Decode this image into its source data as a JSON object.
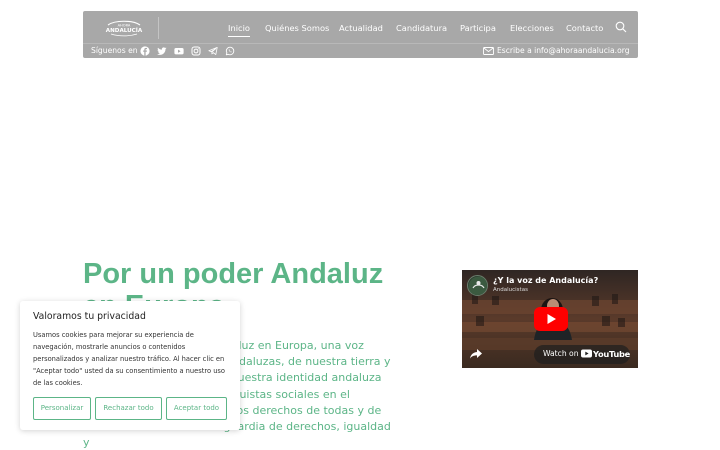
{
  "header": {
    "logo_text": "AHORA ANDALUCÍA",
    "nav": [
      {
        "label": "Inicio",
        "active": true
      },
      {
        "label": "Quiénes Somos"
      },
      {
        "label": "Actualidad"
      },
      {
        "label": "Candidatura"
      },
      {
        "label": "Participa"
      },
      {
        "label": "Elecciones"
      },
      {
        "label": "Contacto"
      }
    ],
    "follow_label": "Síguenos en",
    "social_icons": [
      "facebook-icon",
      "twitter-icon",
      "youtube-icon",
      "instagram-icon",
      "telegram-icon",
      "whatsapp-icon"
    ],
    "contact_text": "Escribe a info@ahoraandalucia.org"
  },
  "main": {
    "headline_line1": "Por un poder Andaluz",
    "headline_line2": "en Europa",
    "body": "Necesitamos un poder Andaluz en Europa, una voz propia de andaluces y de andaluzas, de nuestra tierra y nuestra voz, que proyecte nuestra identidad andaluza que sea vanguardia de conquistas sociales en el Estado, donde se respeten los derechos de todas y de todos. Una Andalucía vanguardia de derechos, igualdad y"
  },
  "video": {
    "title": "¿Y la voz de Andalucía?",
    "channel": "Andalucistas",
    "watch_on": "Watch on",
    "platform": "YouTube"
  },
  "cookie": {
    "title": "Valoramos tu privacidad",
    "text": "Usamos cookies para mejorar su experiencia de navegación, mostrarle anuncios o contenidos personalizados y analizar nuestro tráfico. Al hacer clic en \"Aceptar todo\" usted da su consentimiento a nuestro uso de las cookies.",
    "buttons": {
      "customize": "Personalizar",
      "reject": "Rechazar todo",
      "accept": "Aceptar todo"
    }
  },
  "colors": {
    "accent": "#5cb587",
    "header_bg": "#a8a8a8",
    "text_dark": "#222222"
  }
}
